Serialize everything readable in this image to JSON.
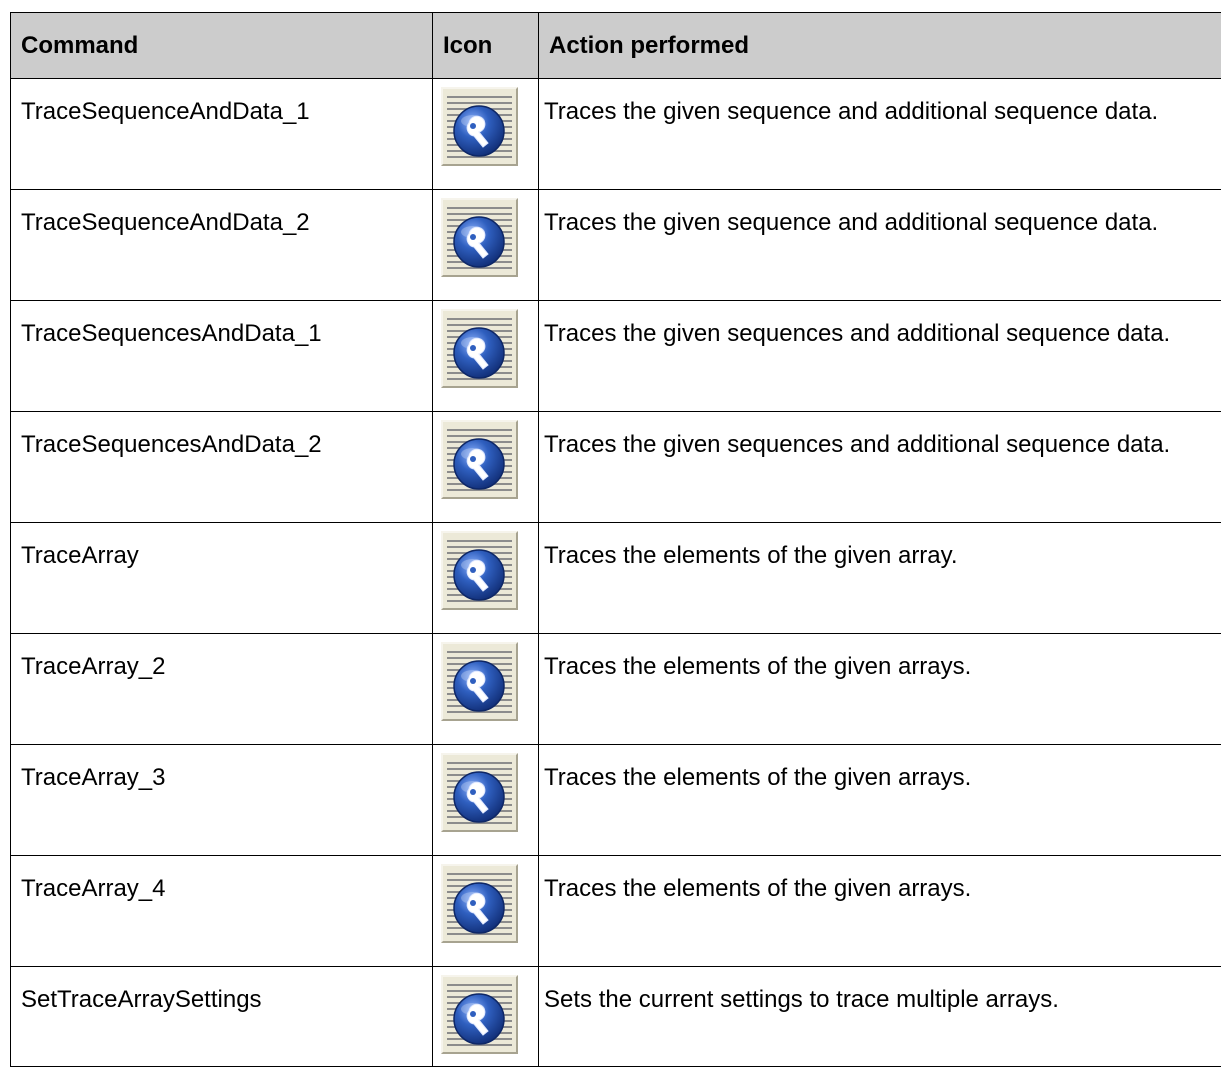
{
  "table": {
    "headers": {
      "command": "Command",
      "icon": "Icon",
      "action": "Action performed"
    },
    "rows": [
      {
        "command": "TraceSequenceAndData_1",
        "icon": "trace-tool-icon",
        "action": "Traces the given sequence and additional sequence data."
      },
      {
        "command": "TraceSequenceAndData_2",
        "icon": "trace-tool-icon",
        "action": "Traces the given sequence and additional sequence data."
      },
      {
        "command": "TraceSequencesAndData_1",
        "icon": "trace-tool-icon",
        "action": "Traces the given sequences and additional sequence data."
      },
      {
        "command": "TraceSequencesAndData_2",
        "icon": "trace-tool-icon",
        "action": "Traces the given sequences and additional sequence data."
      },
      {
        "command": "TraceArray",
        "icon": "trace-tool-icon",
        "action": "Traces the elements of the given array."
      },
      {
        "command": "TraceArray_2",
        "icon": "trace-tool-icon",
        "action": "Traces the elements of the given arrays."
      },
      {
        "command": "TraceArray_3",
        "icon": "trace-tool-icon",
        "action": "Traces the elements of the given arrays."
      },
      {
        "command": "TraceArray_4",
        "icon": "trace-tool-icon",
        "action": "Traces the elements of the given arrays."
      },
      {
        "command": "SetTraceArraySettings",
        "icon": "trace-tool-icon",
        "action": "Sets the current settings to trace multiple arrays."
      }
    ]
  },
  "colors": {
    "header_background": "#cccccc",
    "border": "#000000",
    "icon_button_face": "#ece9d8",
    "icon_circle": "#2f5fbf"
  }
}
